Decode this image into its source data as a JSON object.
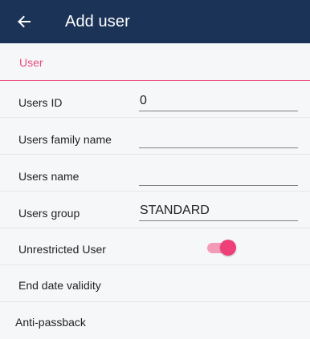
{
  "header": {
    "back_icon": "arrow-left-icon",
    "title": "Add user"
  },
  "section": {
    "title": "User"
  },
  "form": {
    "users_id": {
      "label": "Users ID",
      "value": "0"
    },
    "family_name": {
      "label": "Users family name",
      "value": ""
    },
    "name": {
      "label": "Users name",
      "value": ""
    },
    "group": {
      "label": "Users group",
      "value": "STANDARD"
    },
    "unrestricted": {
      "label": "Unrestricted User",
      "enabled": true
    },
    "end_date": {
      "label": "End date validity"
    },
    "anti_passback": {
      "label": "Anti-passback"
    }
  },
  "colors": {
    "appbar": "#1b3357",
    "accent": "#ef3f78",
    "accent_light": "#f39bb8",
    "background": "#f6f7f9"
  }
}
